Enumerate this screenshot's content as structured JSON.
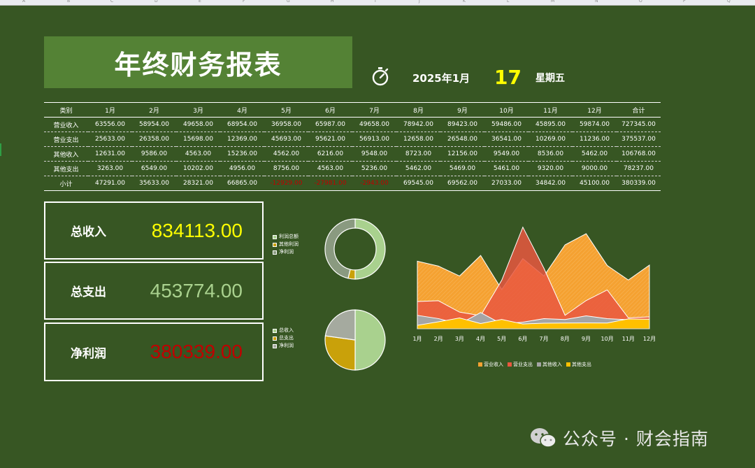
{
  "sheet": {
    "columns": [
      "A",
      "B",
      "C",
      "D",
      "E",
      "F",
      "G",
      "H",
      "I",
      "J",
      "K",
      "L",
      "M",
      "N",
      "O",
      "P",
      "Q"
    ]
  },
  "header": {
    "title": "年终财务报表",
    "date": "2025年1月",
    "day": "17",
    "weekday": "星期五"
  },
  "table": {
    "headers": [
      "类别",
      "1月",
      "2月",
      "3月",
      "4月",
      "5月",
      "6月",
      "7月",
      "8月",
      "9月",
      "10月",
      "11月",
      "12月",
      "合计"
    ],
    "rows": [
      [
        "营业收入",
        "63556.00",
        "58954.00",
        "49658.00",
        "68954.00",
        "36958.00",
        "65987.00",
        "49658.00",
        "78942.00",
        "89423.00",
        "59486.00",
        "45895.00",
        "59874.00",
        "727345.00"
      ],
      [
        "营业支出",
        "25633.00",
        "26358.00",
        "15698.00",
        "12369.00",
        "45693.00",
        "95621.00",
        "56913.00",
        "12658.00",
        "26548.00",
        "36541.00",
        "10269.00",
        "11236.00",
        "375537.00"
      ],
      [
        "其他收入",
        "12631.00",
        "9586.00",
        "4563.00",
        "15236.00",
        "4562.00",
        "6216.00",
        "9548.00",
        "8723.00",
        "12156.00",
        "9549.00",
        "8536.00",
        "5462.00",
        "106768.00"
      ],
      [
        "其他支出",
        "3263.00",
        "6549.00",
        "10202.00",
        "4956.00",
        "8756.00",
        "4563.00",
        "5236.00",
        "5462.00",
        "5469.00",
        "5461.00",
        "9320.00",
        "9000.00",
        "78237.00"
      ],
      [
        "小计",
        "47291.00",
        "35633.00",
        "28321.00",
        "66865.00",
        "-12929.00",
        "-27981.00",
        "-2943.00",
        "69545.00",
        "69562.00",
        "27033.00",
        "34842.00",
        "45100.00",
        "380339.00"
      ]
    ]
  },
  "kpis": [
    {
      "label": "总收入",
      "value": "834113.00",
      "color": "#ffff00"
    },
    {
      "label": "总支出",
      "value": "453774.00",
      "color": "#a9d18e"
    },
    {
      "label": "净利润",
      "value": "380339.00",
      "color": "#c00000"
    }
  ],
  "chart_data": [
    {
      "type": "pie",
      "variant": "donut",
      "legend": [
        "利润总额",
        "其他利润",
        "净利润"
      ],
      "values": [
        380339,
        28531,
        351808
      ],
      "colors": [
        "#a9d18e",
        "#c9a10a",
        "#8a9a80"
      ]
    },
    {
      "type": "pie",
      "legend": [
        "总收入",
        "总支出",
        "净利润"
      ],
      "values": [
        834113,
        453774,
        380339
      ],
      "colors": [
        "#a9d18e",
        "#c9a10a",
        "#a5aa9f"
      ]
    },
    {
      "type": "area",
      "categories": [
        "1月",
        "2月",
        "3月",
        "4月",
        "5月",
        "6月",
        "7月",
        "8月",
        "9月",
        "10月",
        "11月",
        "12月"
      ],
      "series": [
        {
          "name": "营业收入",
          "values": [
            63556,
            58954,
            49658,
            68954,
            36958,
            65987,
            49658,
            78942,
            89423,
            59486,
            45895,
            59874
          ],
          "color": "#f5a131"
        },
        {
          "name": "营业支出",
          "values": [
            25633,
            26358,
            15698,
            12369,
            45693,
            95621,
            56913,
            12658,
            26548,
            36541,
            10269,
            11236
          ],
          "color": "#e9573f"
        },
        {
          "name": "其他收入",
          "values": [
            12631,
            9586,
            4563,
            15236,
            4562,
            6216,
            9548,
            8723,
            12156,
            9549,
            8536,
            5462
          ],
          "color": "#a5a5a5"
        },
        {
          "name": "其他支出",
          "values": [
            3263,
            6549,
            10202,
            4956,
            8756,
            4563,
            5236,
            5462,
            5469,
            5461,
            9320,
            9000
          ],
          "color": "#ffc000"
        }
      ],
      "ylim": [
        0,
        100000
      ],
      "legend_position": "bottom"
    }
  ],
  "watermark": {
    "text": "公众号 · 财会指南"
  }
}
